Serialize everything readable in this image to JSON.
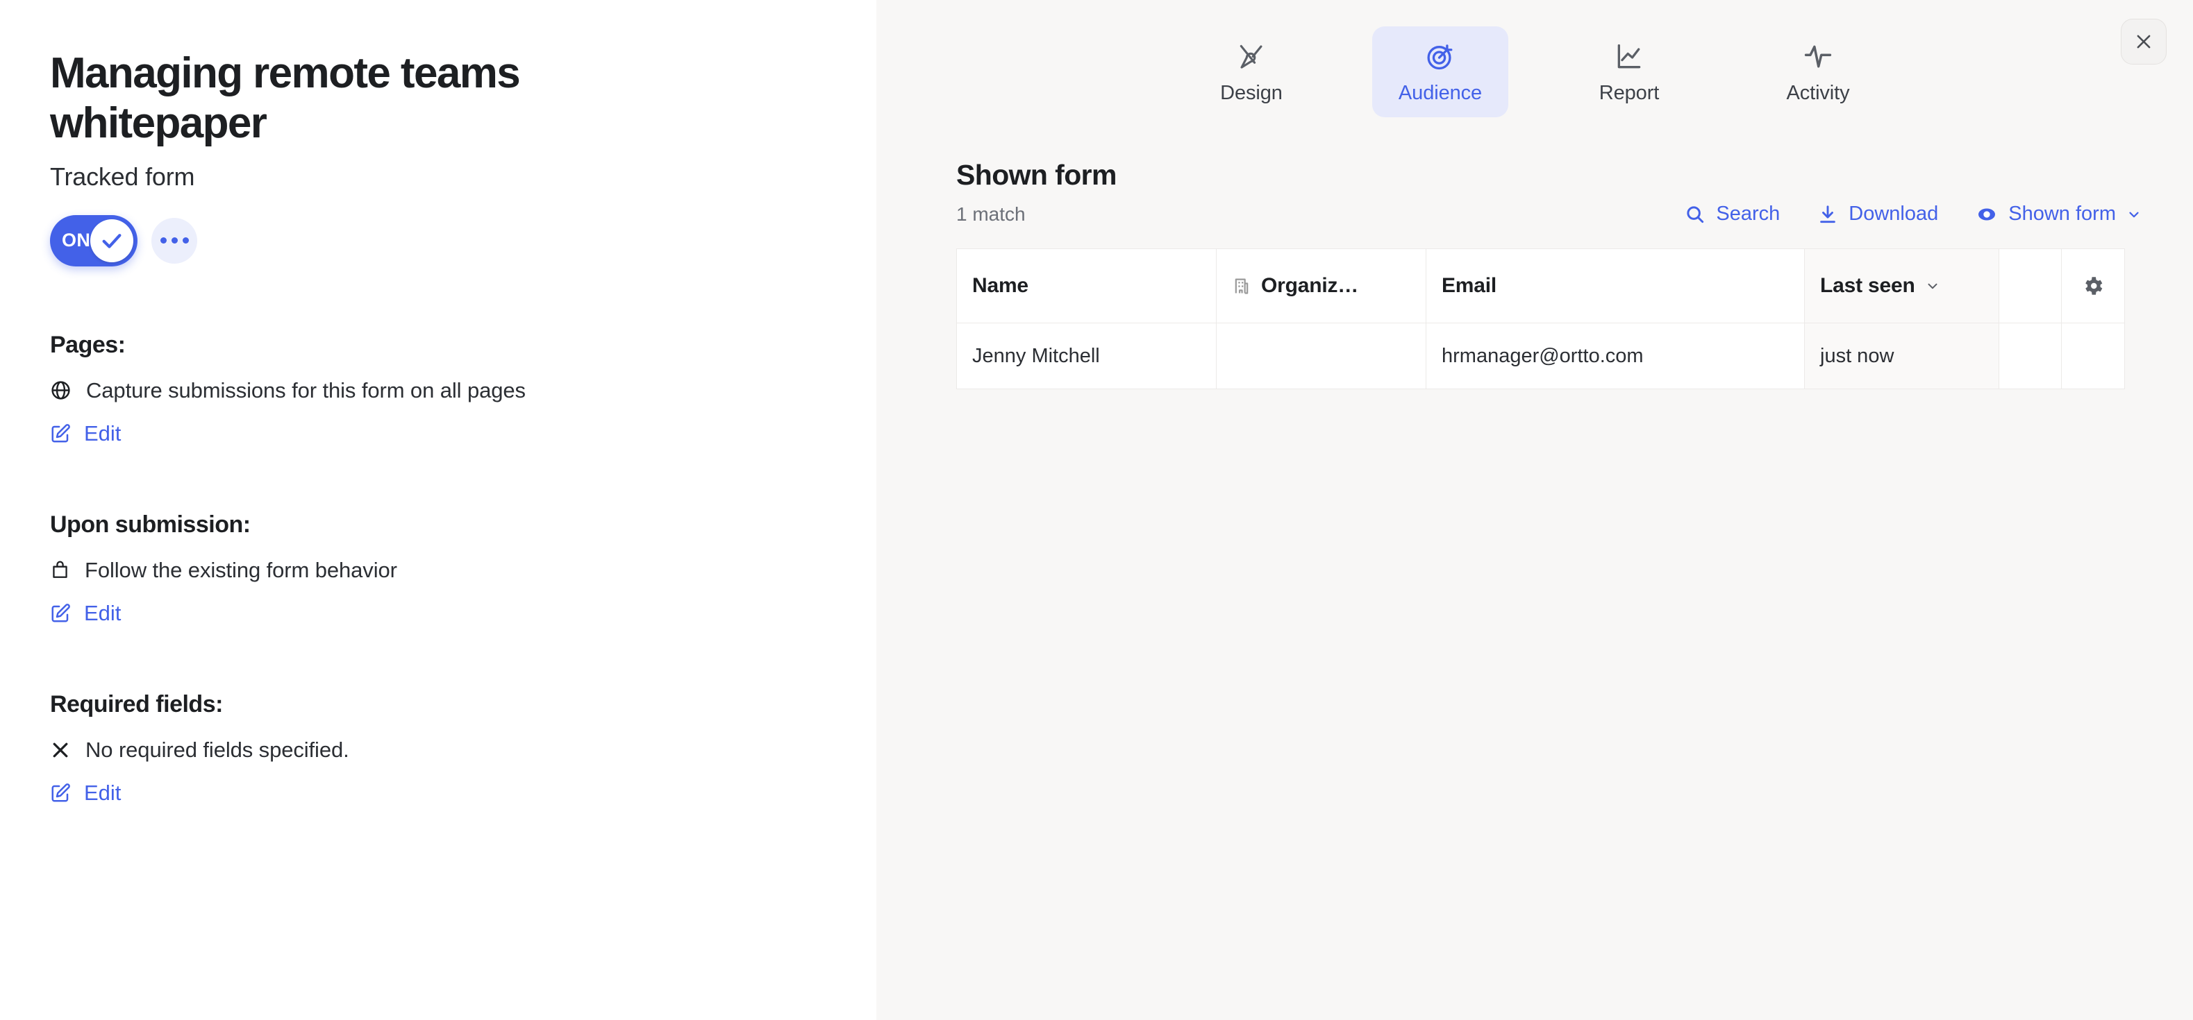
{
  "colors": {
    "accent": "#4361e8",
    "accent_soft": "#e6e9fb",
    "panel_bg": "#f8f7f6",
    "text": "#1d1f22",
    "muted": "#6c7078",
    "icon_gray": "#5b5f66",
    "border": "#eceae8"
  },
  "left_panel": {
    "title": "Managing remote teams whitepaper",
    "subtitle": "Tracked form",
    "toggle": {
      "label": "ON",
      "state": "on",
      "knob_icon": "check-icon"
    },
    "more_button_icon": "ellipsis-icon",
    "sections": [
      {
        "heading": "Pages:",
        "row_icon": "globe-icon",
        "row_text": "Capture submissions for this form on all pages",
        "edit_icon": "edit-pencil-icon",
        "edit_label": "Edit"
      },
      {
        "heading": "Upon submission:",
        "row_icon": "bag-icon",
        "row_text": "Follow the existing form behavior",
        "edit_icon": "edit-pencil-icon",
        "edit_label": "Edit"
      },
      {
        "heading": "Required fields:",
        "row_icon": "cross-icon",
        "row_text": "No required fields specified.",
        "edit_icon": "edit-pencil-icon",
        "edit_label": "Edit"
      }
    ]
  },
  "right_panel": {
    "tabs": [
      {
        "label": "Design",
        "icon": "design-pen-icon",
        "active": false
      },
      {
        "label": "Audience",
        "icon": "target-icon",
        "active": true
      },
      {
        "label": "Report",
        "icon": "line-chart-icon",
        "active": false
      },
      {
        "label": "Activity",
        "icon": "pulse-wave-icon",
        "active": false
      }
    ],
    "close_icon": "close-icon",
    "content": {
      "title": "Shown form",
      "match_count": "1 match",
      "toolbar": [
        {
          "label": "Search",
          "icon": "search-icon"
        },
        {
          "label": "Download",
          "icon": "download-icon"
        },
        {
          "label": "Shown form",
          "icon": "eye-icon",
          "has_chevron": true
        }
      ],
      "table": {
        "columns": [
          {
            "label": "Name",
            "icon": null,
            "sorted": false,
            "chevron": false
          },
          {
            "label": "Organiz…",
            "icon": "organization-icon",
            "sorted": false,
            "chevron": false
          },
          {
            "label": "Email",
            "icon": null,
            "sorted": false,
            "chevron": false
          },
          {
            "label": "Last seen",
            "icon": null,
            "sorted": true,
            "chevron": true
          },
          {
            "label": "",
            "icon": null,
            "sorted": false,
            "chevron": false
          },
          {
            "label": "",
            "icon": "gear-icon",
            "sorted": false,
            "chevron": false
          }
        ],
        "rows": [
          {
            "name": "Jenny Mitchell",
            "organization": "",
            "email": "hrmanager@ortto.com",
            "last_seen": "just now",
            "blank": "",
            "gear": ""
          }
        ]
      }
    }
  }
}
